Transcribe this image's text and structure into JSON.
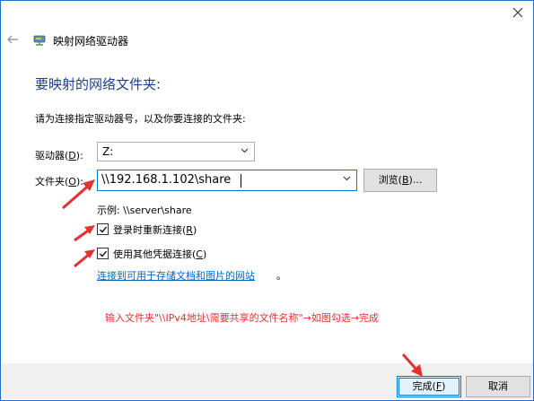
{
  "window": {
    "title": "映射网络驱动器"
  },
  "dialog": {
    "heading": "要映射的网络文件夹:",
    "instruction": "请为连接指定驱动器号，以及你要连接的文件夹:",
    "drive": {
      "label_pre": "驱动器(",
      "label_key": "D",
      "label_post": "):",
      "value": "Z:"
    },
    "folder": {
      "label_pre": "文件夹(",
      "label_key": "O",
      "label_post": "):",
      "value": "\\\\192.168.1.102\\share"
    },
    "browse": {
      "label_pre": "浏览(",
      "label_key": "B",
      "label_post": ")..."
    },
    "example": "示例: \\\\server\\share",
    "reconnect": {
      "label_pre": "登录时重新连接(",
      "label_key": "R",
      "label_post": ")",
      "checked": true
    },
    "other_credentials": {
      "label_pre": "使用其他凭据连接(",
      "label_key": "C",
      "label_post": ")",
      "checked": true
    },
    "link": "连接到可用于存储文档和图片的网站",
    "link_suffix": "。"
  },
  "annotation": "输入文件夹\"\\\\IPv4地址\\需要共享的文件名称\"→如图勾选→完成",
  "footer": {
    "finish": {
      "label_pre": "完成(",
      "label_key": "F",
      "label_post": ")"
    },
    "cancel": "取消"
  },
  "colors": {
    "heading": "#1f3f8c",
    "link": "#0066cc",
    "annotation": "#e53030",
    "accent": "#0078d7"
  },
  "icons": [
    "close-icon",
    "back-arrow-icon",
    "network-drive-icon",
    "chevron-down-icon",
    "checkmark-icon"
  ]
}
